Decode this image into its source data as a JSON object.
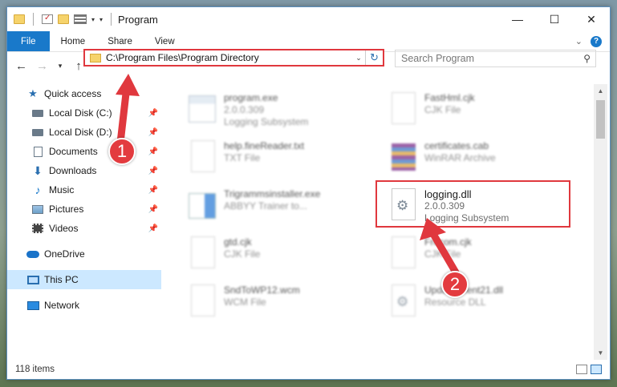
{
  "window": {
    "title": "Program"
  },
  "ribbon": {
    "tabs": [
      "File",
      "Home",
      "Share",
      "View"
    ]
  },
  "address": {
    "path": "C:\\Program Files\\Program Directory"
  },
  "search": {
    "placeholder": "Search Program"
  },
  "sidebar": {
    "items": [
      {
        "label": "Quick access",
        "icon": "star-icon"
      },
      {
        "label": "Local Disk (C:)",
        "icon": "drive-icon",
        "pinned": true
      },
      {
        "label": "Local Disk (D:)",
        "icon": "drive-icon",
        "pinned": true
      },
      {
        "label": "Documents",
        "icon": "documents-icon",
        "pinned": true
      },
      {
        "label": "Downloads",
        "icon": "downloads-icon",
        "pinned": true
      },
      {
        "label": "Music",
        "icon": "music-icon",
        "pinned": true
      },
      {
        "label": "Pictures",
        "icon": "pictures-icon",
        "pinned": true
      },
      {
        "label": "Videos",
        "icon": "videos-icon",
        "pinned": true
      },
      {
        "label": "OneDrive",
        "icon": "onedrive-icon"
      },
      {
        "label": "This PC",
        "icon": "this-pc-icon",
        "selected": true
      },
      {
        "label": "Network",
        "icon": "network-icon"
      }
    ]
  },
  "files": [
    {
      "name": "program.exe",
      "line2": "2.0.0.309",
      "line3": "Logging Subsystem",
      "icon": "exe"
    },
    {
      "name": "help.fineReader.txt",
      "line2": "TXT File",
      "line3": "",
      "icon": "file"
    },
    {
      "name": "Trigrammsinstaller.exe",
      "line2": "ABBYY Trainer to...",
      "line3": "",
      "icon": "installer"
    },
    {
      "name": "gtd.cjk",
      "line2": "CJK File",
      "line3": "",
      "icon": "file"
    },
    {
      "name": "SndToWP12.wcm",
      "line2": "WCM File",
      "line3": "",
      "icon": "file"
    },
    {
      "name": "FastHml.cjk",
      "line2": "CJK File",
      "line3": "",
      "icon": "file"
    },
    {
      "name": "certificates.cab",
      "line2": "WinRAR Archive",
      "line3": "",
      "icon": "rar"
    },
    {
      "name": "logging.dll",
      "line2": "2.0.0.309",
      "line3": "Logging Subsystem",
      "icon": "dll"
    },
    {
      "name": "Frecom.cjk",
      "line2": "CJK File",
      "line3": "",
      "icon": "file"
    },
    {
      "name": "UpdateClient21.dll",
      "line2": "Resource DLL",
      "line3": "",
      "icon": "dll"
    }
  ],
  "status": {
    "count": "118 items"
  },
  "annotations": [
    "1",
    "2"
  ],
  "colors": {
    "accent": "#1979ca",
    "highlight": "#e0383e",
    "selected": "#cce8ff"
  }
}
